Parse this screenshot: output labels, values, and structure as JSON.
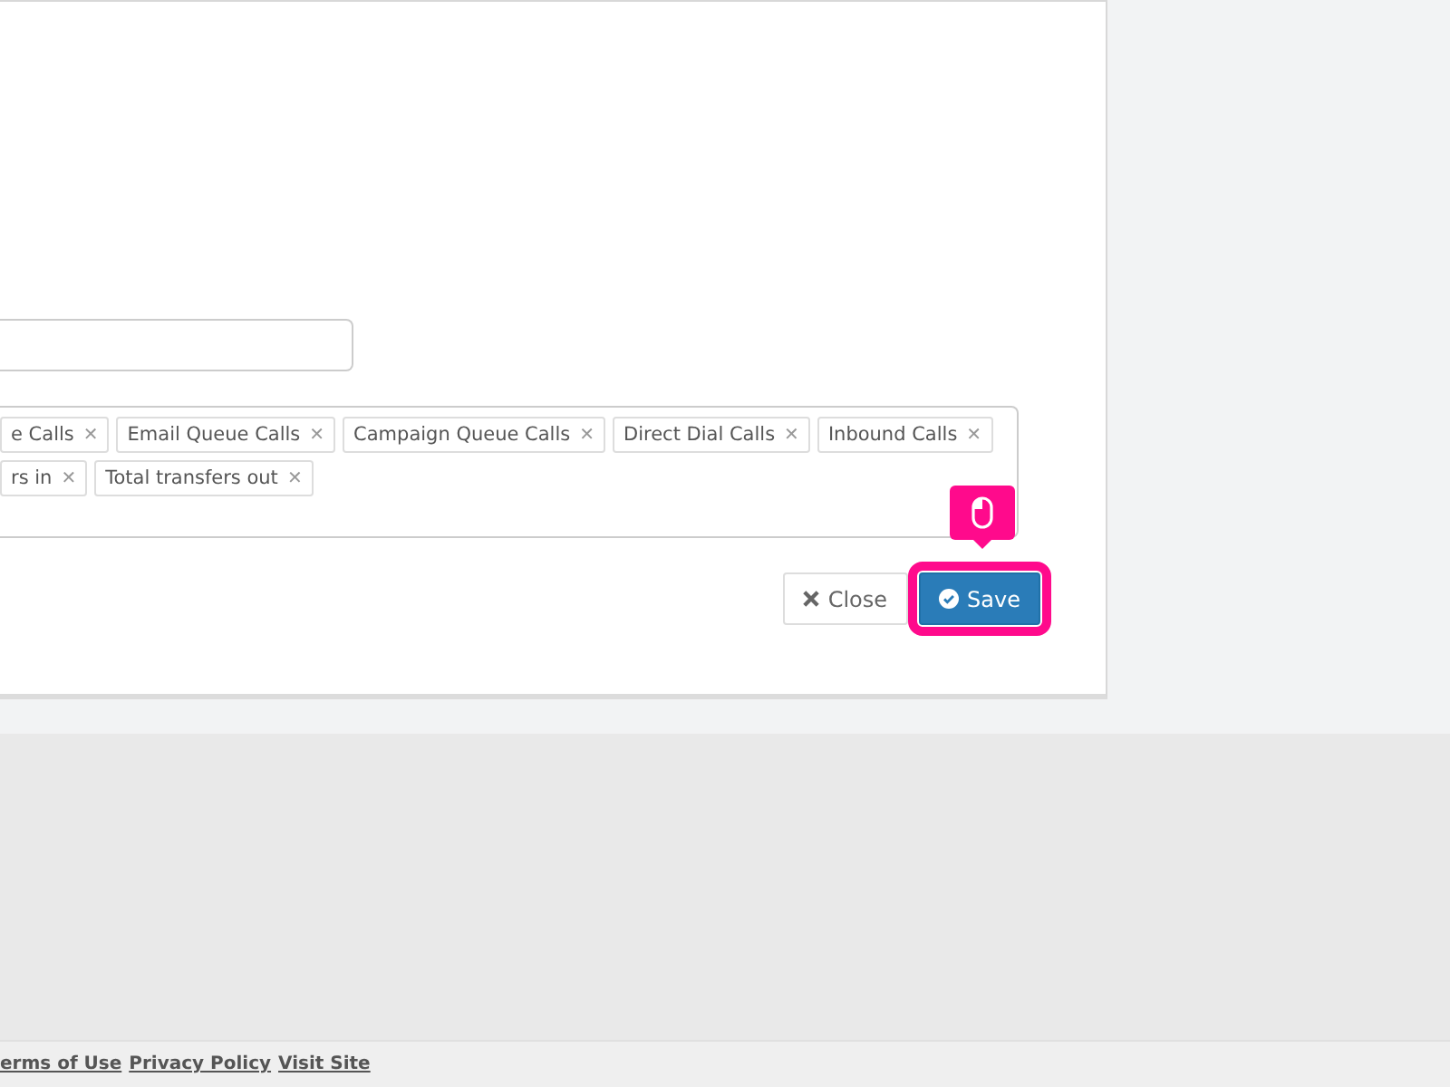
{
  "modal": {
    "tags_row_1": [
      {
        "label": "e Calls",
        "remove": "✕"
      },
      {
        "label": "Email Queue Calls",
        "remove": "✕"
      },
      {
        "label": "Campaign Queue Calls",
        "remove": "✕"
      },
      {
        "label": "Direct Dial Calls",
        "remove": "✕"
      },
      {
        "label": "Inbound Calls",
        "remove": "✕"
      }
    ],
    "tags_row_2": [
      {
        "label": "rs in",
        "remove": "✕"
      },
      {
        "label": "Total transfers out",
        "remove": "✕"
      }
    ],
    "buttons": [
      {
        "kind": "close",
        "label": "Close",
        "highlighted": false
      },
      {
        "kind": "save",
        "label": "Save",
        "highlighted": true
      }
    ]
  },
  "footer": {
    "links": [
      "erms of Use",
      "Privacy Policy",
      "Visit Site"
    ]
  }
}
